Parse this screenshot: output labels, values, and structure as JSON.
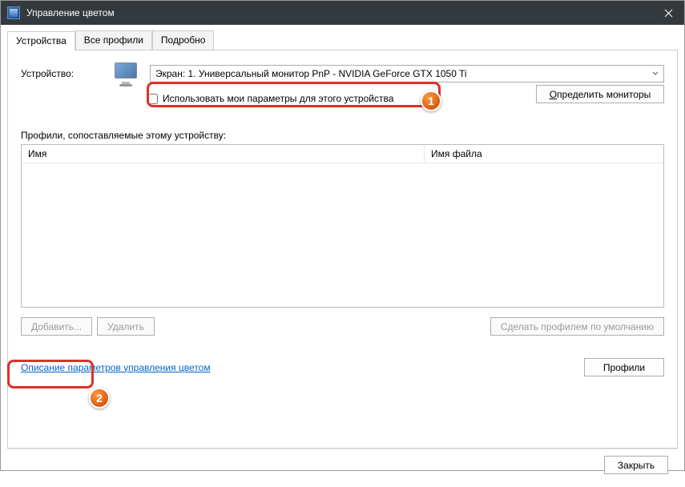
{
  "window": {
    "title": "Управление цветом"
  },
  "tabs": {
    "items": [
      {
        "label": "Устройства"
      },
      {
        "label": "Все профили"
      },
      {
        "label": "Подробно"
      }
    ]
  },
  "device": {
    "label": "Устройство:",
    "selected": "Экран: 1. Универсальный монитор PnP - NVIDIA GeForce GTX 1050 Ti",
    "use_my_settings_label": "Использовать мои параметры для этого устройства",
    "identify_label": "Определить мониторы"
  },
  "profiles": {
    "section_label": "Профили, сопоставляемые этому устройству:",
    "columns": {
      "name": "Имя",
      "file": "Имя файла"
    }
  },
  "actions": {
    "add": "Добавить...",
    "remove": "Удалить",
    "set_default": "Сделать профилем по умолчанию"
  },
  "help": {
    "link": "Описание параметров управления цветом",
    "profiles_btn": "Профили"
  },
  "footer": {
    "close": "Закрыть"
  },
  "annotations": {
    "step1": "1",
    "step2": "2"
  }
}
